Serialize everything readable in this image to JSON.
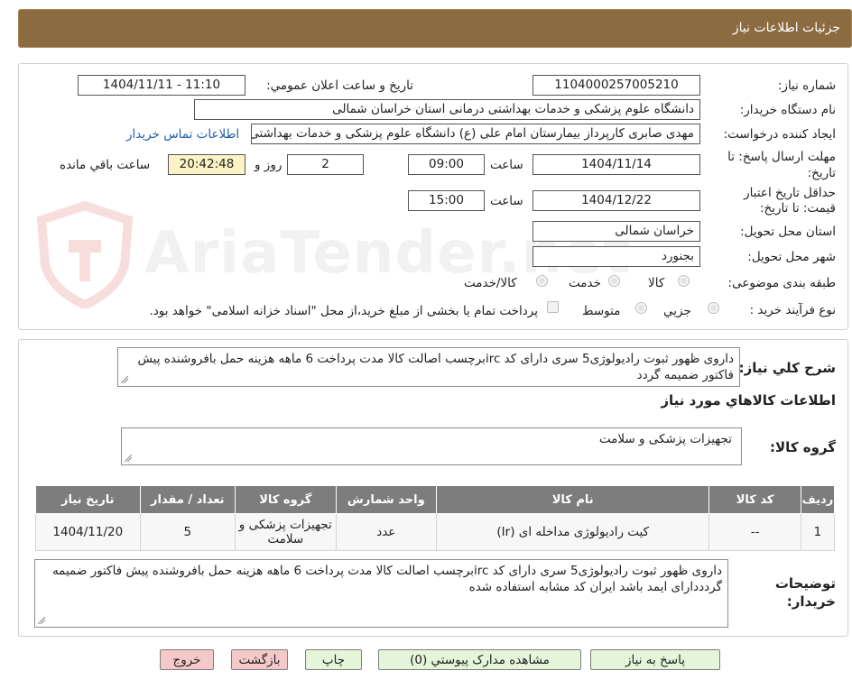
{
  "header": {
    "title": "جزئیات اطلاعات نیاز"
  },
  "watermark": {
    "text": "AriaTender.net"
  },
  "form": {
    "need_number_label": "شماره نیاز:",
    "need_number": "1104000257005210",
    "announce_label": "تاریخ و ساعت اعلان عمومي:",
    "announce_value": "1404/11/11 - 11:10",
    "buyer_org_label": "نام دستگاه خريدار:",
    "buyer_org": "دانشگاه علوم پزشکی و خدمات بهداشتی درمانی استان خراسان شمالی",
    "requester_label": "ايجاد کننده درخواست:",
    "requester": "مهدی صابری کارپرداز بیمارستان امام علی (ع) دانشگاه علوم پزشکی و خدمات بهداشتی",
    "contact_link": "اطلاعات تماس خريدار",
    "reply_deadline_label": "مهلت ارسال پاسخ: تا تاریخ:",
    "reply_date": "1404/11/14",
    "time_label": "ساعت",
    "reply_time": "09:00",
    "days_value": "2",
    "days_label": "روز و",
    "remaining_time": "20:42:48",
    "remaining_label": "ساعت باقي مانده",
    "validity_label": "حداقل تاریخ اعتبار قیمت: تا تاریخ:",
    "validity_date": "1404/12/22",
    "validity_time": "15:00",
    "province_label": "استان محل تحویل:",
    "province": "خراسان شمالی",
    "city_label": "شهر محل تحویل:",
    "city": "بجنورد",
    "category_label": "طبقه بندی موضوعی:",
    "category_options": [
      "کالا",
      "خدمت",
      "کالا/خدمت"
    ],
    "process_label": "نوع فرآیند خرید :",
    "process_options": [
      "جزيي",
      "متوسط"
    ],
    "payment_note": "پرداخت تمام یا بخشی از مبلغ خرید،از محل \"اسناد خزانه اسلامی\" خواهد بود."
  },
  "summary": {
    "label": "شرح کلي نياز:",
    "text": "داروی ظهور ثبوت رادیولوژی5 سری دارای کد ircبرچسب اصالت کالا مدت پرداخت 6 ماهه هزینه حمل بافروشنده پیش فاکتور ضمیمه گردد"
  },
  "goods": {
    "section_title": "اطلاعات کالاهاي مورد نياز",
    "group_label": "گروه کالا:",
    "group_value": "تجهیزات پزشکی و سلامت",
    "columns": [
      "رديف",
      "کد کالا",
      "نام کالا",
      "واحد شمارش",
      "گروه کالا",
      "تعداد / مقدار",
      "تاريخ نياز"
    ],
    "rows": [
      [
        "1",
        "--",
        "کیت رادیولوژی مداخله ای (Ir)",
        "عدد",
        "تجهیزات پزشکی و سلامت",
        "5",
        "1404/11/20"
      ]
    ]
  },
  "buyer_notes": {
    "label": "توضيحات خريدار:",
    "text": "داروی ظهور ثبوت رادیولوژی5 سری دارای کد ircبرچسب اصالت کالا مدت پرداخت 6 ماهه هزینه حمل بافروشنده پیش فاکتور ضمیمه گردددارای ایمد باشد ایران کد مشابه استفاده شده"
  },
  "buttons": {
    "reply": "پاسخ به نياز",
    "attachments": "مشاهده مدارک پيوستي (0)",
    "print": "چاپ",
    "back": "بازگشت",
    "exit": "خروج"
  }
}
